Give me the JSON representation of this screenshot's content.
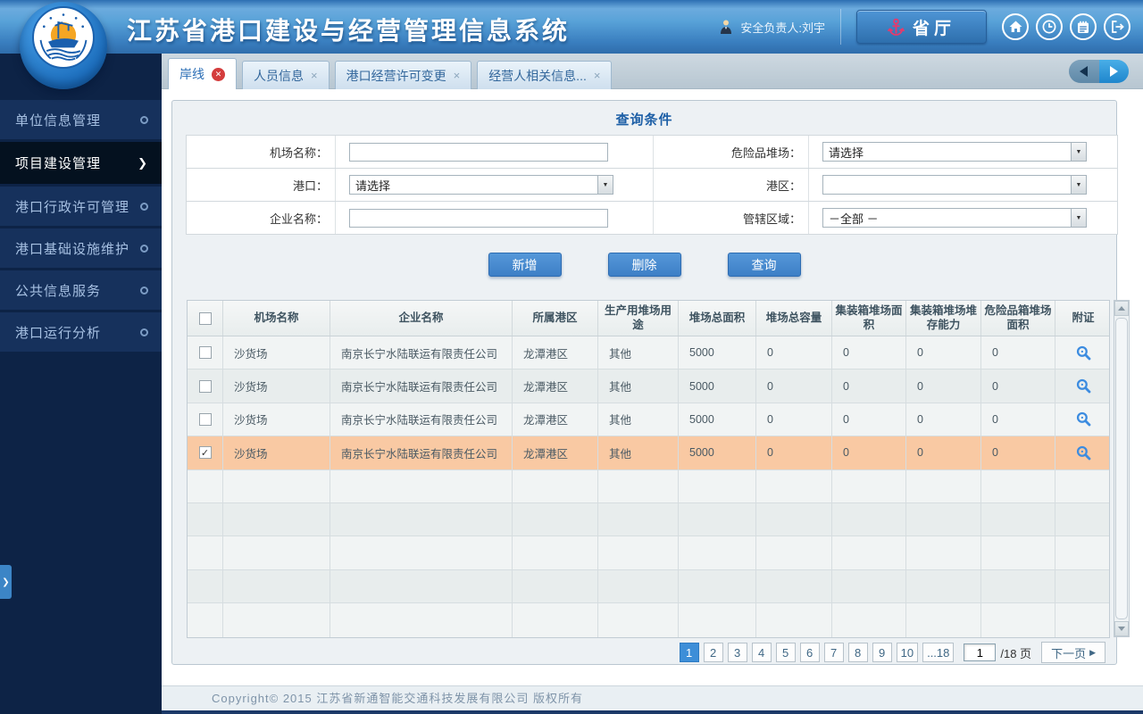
{
  "glyphs": {
    "close_badge": "✕",
    "close": "×",
    "dropdown": "▼",
    "chevron_right": "❯",
    "check": "✓",
    "next_arrow": "▶"
  },
  "colors": {
    "accent_blue": "#3d8ed8",
    "selected_row": "#f9c9a3",
    "sidebar_navy": "#0d2346",
    "tab_close_red": "#d43c3c",
    "anchor_pink": "#e8396b"
  },
  "header": {
    "title": "江苏省港口建设与经营管理信息系统",
    "user_label": "安全负责人:刘宇",
    "province_button": "省厅",
    "icons": [
      "person-icon",
      "anchor-icon",
      "home-icon",
      "clock-icon",
      "notepad-icon",
      "logout-icon"
    ]
  },
  "tabbar": {
    "tabs": [
      {
        "label": "岸线",
        "active": true
      },
      {
        "label": "人员信息",
        "active": false
      },
      {
        "label": "港口经营许可变更",
        "active": false
      },
      {
        "label": "经营人相关信息...",
        "active": false
      }
    ]
  },
  "sidebar": {
    "items": [
      {
        "label": "单位信息管理",
        "active": false
      },
      {
        "label": "项目建设管理",
        "active": true
      },
      {
        "label": "港口行政许可管理",
        "active": false
      },
      {
        "label": "港口基础设施维护",
        "active": false
      },
      {
        "label": "公共信息服务",
        "active": false
      },
      {
        "label": "港口运行分析",
        "active": false
      }
    ]
  },
  "query": {
    "title": "查询条件",
    "fields": [
      {
        "name": "airport-name",
        "label": "机场名称：",
        "type": "text",
        "value": ""
      },
      {
        "name": "dangerous-goods-yard",
        "label": "危险品堆场：",
        "type": "select",
        "value": "请选择"
      },
      {
        "name": "port",
        "label": "港口：",
        "type": "select",
        "value": "请选择"
      },
      {
        "name": "port-area",
        "label": "港区：",
        "type": "select",
        "value": ""
      },
      {
        "name": "company-name",
        "label": "企业名称：",
        "type": "text",
        "value": ""
      },
      {
        "name": "jurisdiction",
        "label": "管辖区域：",
        "type": "select",
        "value": "－全部 －"
      }
    ],
    "buttons": [
      {
        "name": "add-button",
        "label": "新增"
      },
      {
        "name": "delete-button",
        "label": "删除"
      },
      {
        "name": "query-button",
        "label": "查询"
      }
    ]
  },
  "table": {
    "headers": [
      "机场名称",
      "企业名称",
      "所属港区",
      "生产用堆场用途",
      "堆场总面积",
      "堆场总容量",
      "集装箱堆场面积",
      "集装箱堆场堆存能力",
      "危险品箱堆场面积",
      "附证"
    ],
    "rows": [
      {
        "checked": false,
        "selected": false,
        "cells": [
          "沙货场",
          "南京长宁水陆联运有限责任公司",
          "龙潭港区",
          "其他",
          "5000",
          "0",
          "0",
          "0",
          "0"
        ]
      },
      {
        "checked": false,
        "selected": false,
        "cells": [
          "沙货场",
          "南京长宁水陆联运有限责任公司",
          "龙潭港区",
          "其他",
          "5000",
          "0",
          "0",
          "0",
          "0"
        ]
      },
      {
        "checked": false,
        "selected": false,
        "cells": [
          "沙货场",
          "南京长宁水陆联运有限责任公司",
          "龙潭港区",
          "其他",
          "5000",
          "0",
          "0",
          "0",
          "0"
        ]
      },
      {
        "checked": true,
        "selected": true,
        "cells": [
          "沙货场",
          "南京长宁水陆联运有限责任公司",
          "龙潭港区",
          "其他",
          "5000",
          "0",
          "0",
          "0",
          "0"
        ]
      }
    ],
    "empty_row_count": 5
  },
  "pagination": {
    "pages": [
      "1",
      "2",
      "3",
      "4",
      "5",
      "6",
      "7",
      "8",
      "9",
      "10",
      "...18"
    ],
    "active": "1",
    "page_input": "1",
    "total_label": "/18 页",
    "next_label": "下一页"
  },
  "footer": {
    "copyright": "Copyright©  2015  江苏省新通智能交通科技发展有限公司  版权所有"
  }
}
